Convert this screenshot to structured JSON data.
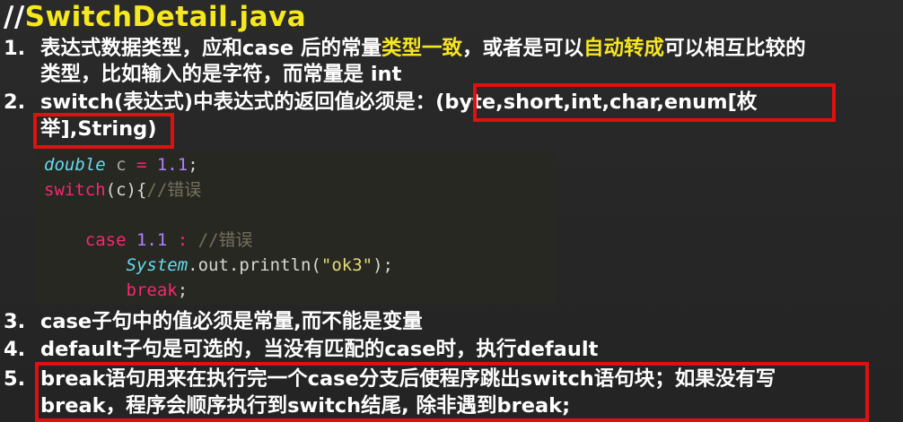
{
  "title": {
    "prefix": "//",
    "text": "SwitchDetail.java"
  },
  "items": [
    {
      "number": "1.",
      "line1": {
        "a": "表达式数据类型，应和case 后的常量",
        "h1": "类型一致",
        "b": "，或者是可以",
        "h2": "自动转成",
        "c": "可以相互比较的"
      },
      "line2": "类型，比如输入的是字符，而常量是 int"
    },
    {
      "number": "2.",
      "line1": {
        "a": "switch(表达式)中表达式的返回值必须是：",
        "boxed": "(byte,short,int,char,enum[枚"
      },
      "line2": "举],String)"
    },
    {
      "number": "3.",
      "line1": "case子句中的值必须是常量,而不能是变量"
    },
    {
      "number": "4.",
      "line1": "default子句是可选的，当没有匹配的case时，执行default"
    },
    {
      "number": "5.",
      "line1": "break语句用来在执行完一个case分支后使程序跳出switch语句块；如果没有写",
      "line2": "break，程序会顺序执行到switch结尾, 除非遇到break;"
    }
  ],
  "code": {
    "l1": {
      "t": "double",
      "v": " c ",
      "op": "=",
      "n": " 1.1",
      "end": ";"
    },
    "l2": {
      "kw": "switch",
      "args": "(c){",
      "c": "//错误"
    },
    "l4": {
      "indent": "    ",
      "kw": "case",
      "n": " 1.1",
      "colon": " :",
      "c": " //错误"
    },
    "l5": {
      "indent": "        ",
      "cls": "System",
      "dot1": ".out.",
      "m": "println(",
      "s": "\"ok3\"",
      "end": ");"
    },
    "l6": {
      "indent": "        ",
      "kw": "break",
      "end": ";"
    }
  },
  "colors": {
    "background": "#262626",
    "title": "#f5e81c",
    "highlight": "#f6e620",
    "box": "#e01010",
    "code_bg": "#272822"
  }
}
